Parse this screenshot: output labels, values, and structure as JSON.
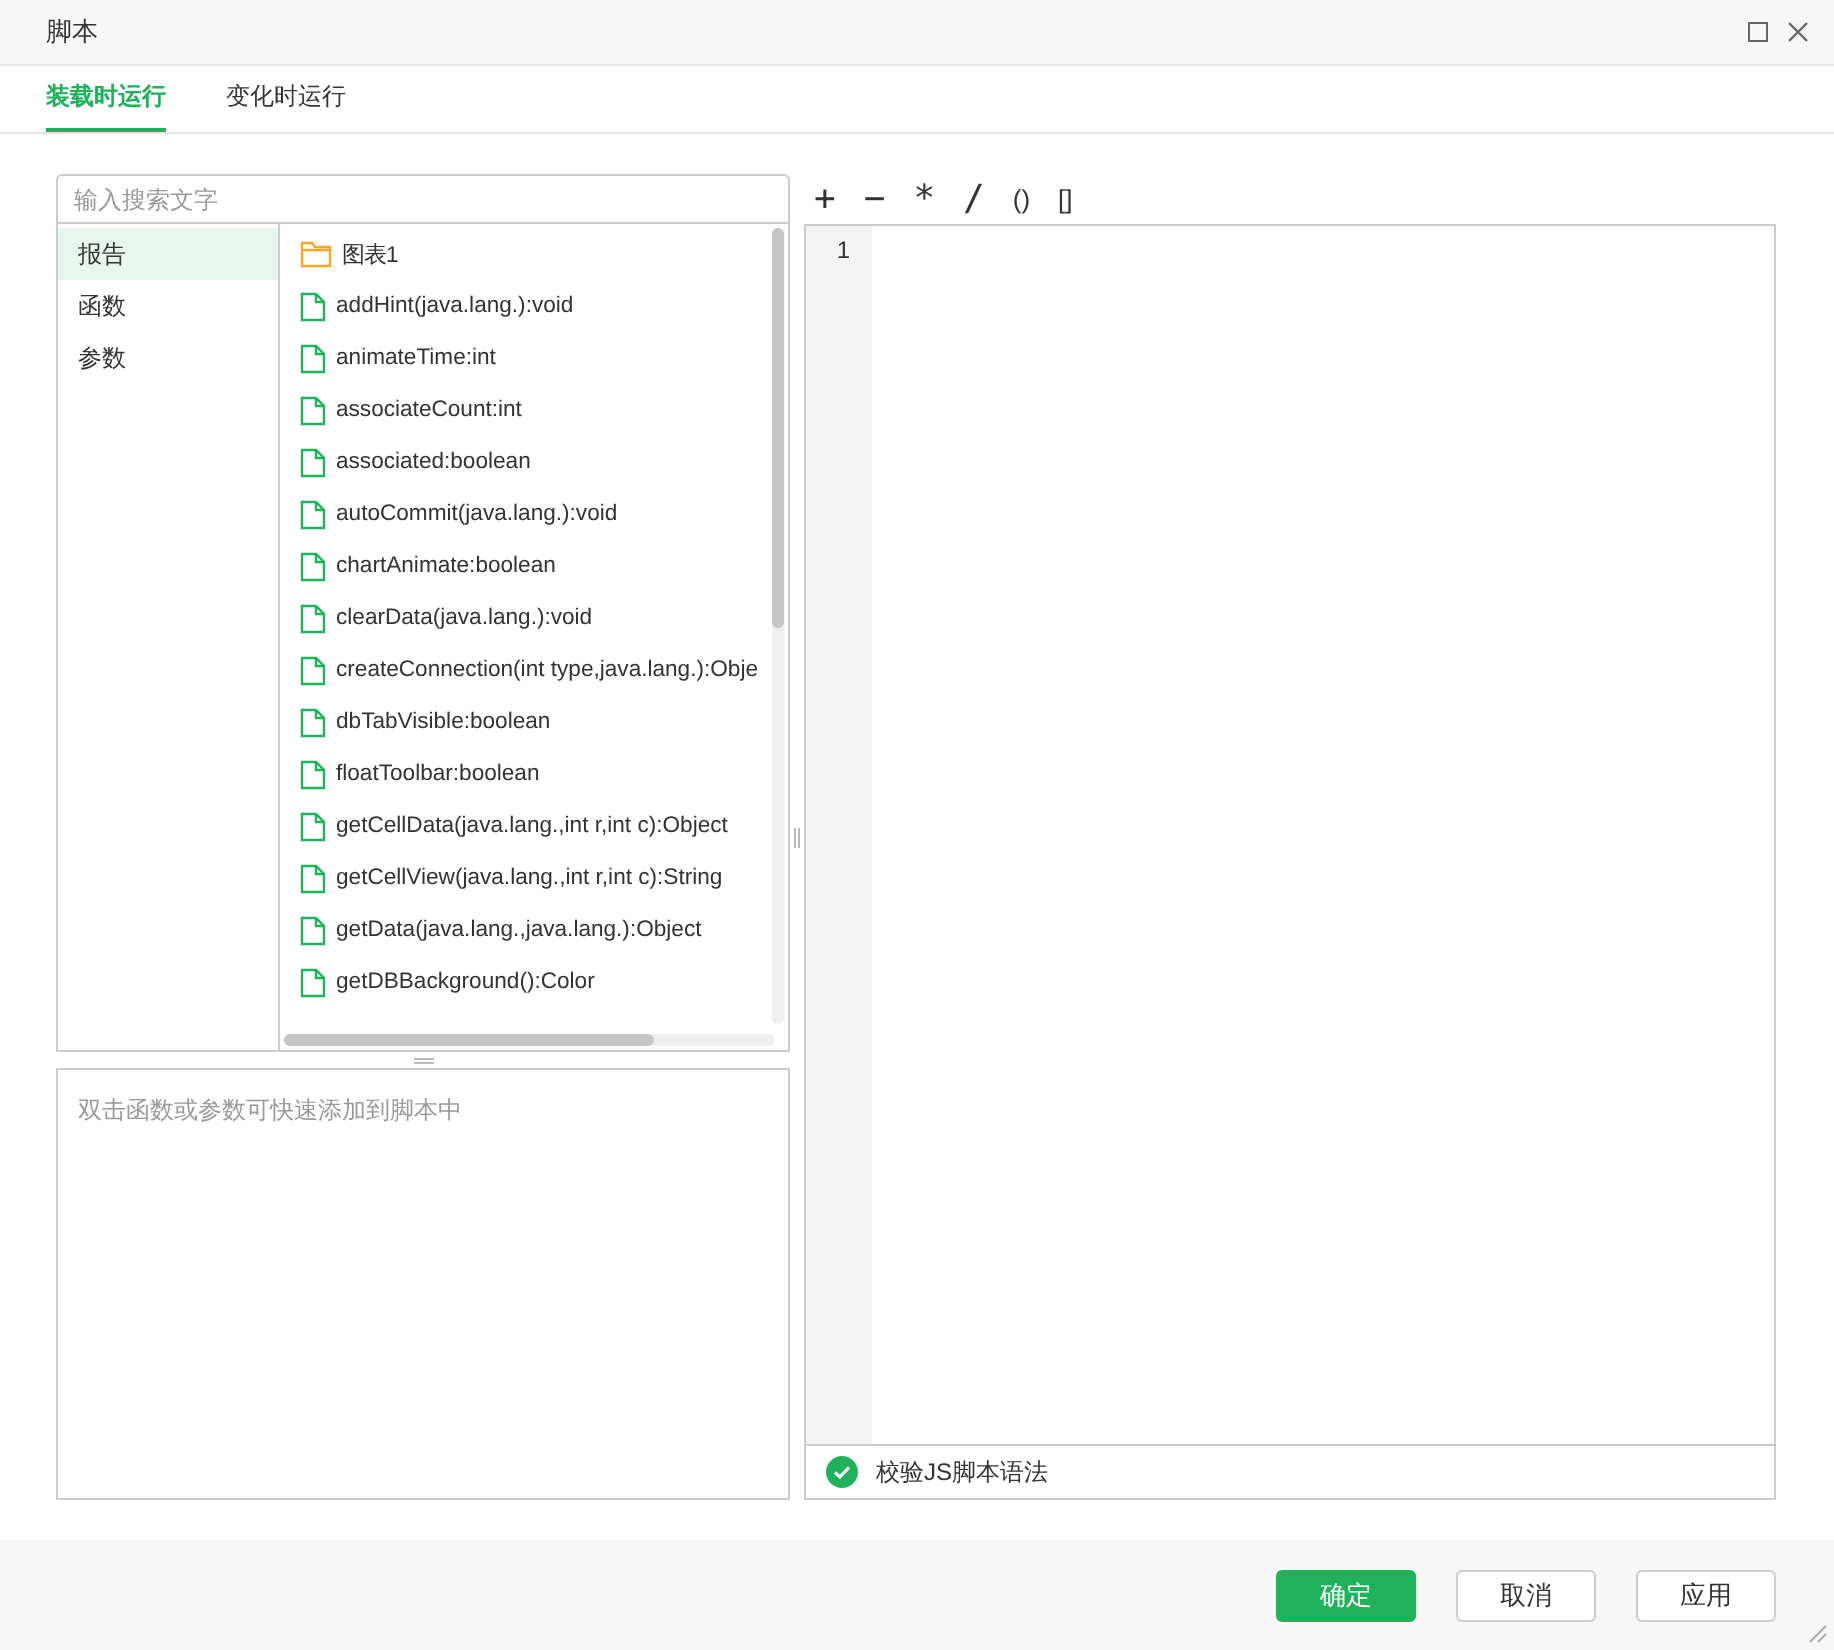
{
  "window": {
    "title": "脚本"
  },
  "tabs": [
    {
      "label": "装载时运行",
      "selected": true
    },
    {
      "label": "变化时运行",
      "selected": false
    }
  ],
  "search": {
    "placeholder": "输入搜索文字"
  },
  "categories": [
    {
      "label": "报告",
      "selected": true
    },
    {
      "label": "函数",
      "selected": false
    },
    {
      "label": "参数",
      "selected": false
    }
  ],
  "members": [
    {
      "kind": "folder",
      "label": "图表1"
    },
    {
      "kind": "member",
      "label": "addHint(java.lang.):void"
    },
    {
      "kind": "member",
      "label": "animateTime:int"
    },
    {
      "kind": "member",
      "label": "associateCount:int"
    },
    {
      "kind": "member",
      "label": "associated:boolean"
    },
    {
      "kind": "member",
      "label": "autoCommit(java.lang.):void"
    },
    {
      "kind": "member",
      "label": "chartAnimate:boolean"
    },
    {
      "kind": "member",
      "label": "clearData(java.lang.):void"
    },
    {
      "kind": "member",
      "label": "createConnection(int type,java.lang.):Obje"
    },
    {
      "kind": "member",
      "label": "dbTabVisible:boolean"
    },
    {
      "kind": "member",
      "label": "floatToolbar:boolean"
    },
    {
      "kind": "member",
      "label": "getCellData(java.lang.,int r,int c):Object"
    },
    {
      "kind": "member",
      "label": "getCellView(java.lang.,int r,int c):String"
    },
    {
      "kind": "member",
      "label": "getData(java.lang.,java.lang.):Object"
    },
    {
      "kind": "member",
      "label": "getDBBackground():Color"
    }
  ],
  "hint": "双击函数或参数可快速添加到脚本中",
  "operators": [
    "+",
    "−",
    "*",
    "/",
    "()",
    "[]"
  ],
  "editor": {
    "line_numbers": [
      "1"
    ]
  },
  "validate": {
    "label": "校验JS脚本语法",
    "checked": true
  },
  "buttons": [
    {
      "label": "确定",
      "kind": "primary"
    },
    {
      "label": "取消",
      "kind": "default"
    },
    {
      "label": "应用",
      "kind": "default"
    }
  ]
}
